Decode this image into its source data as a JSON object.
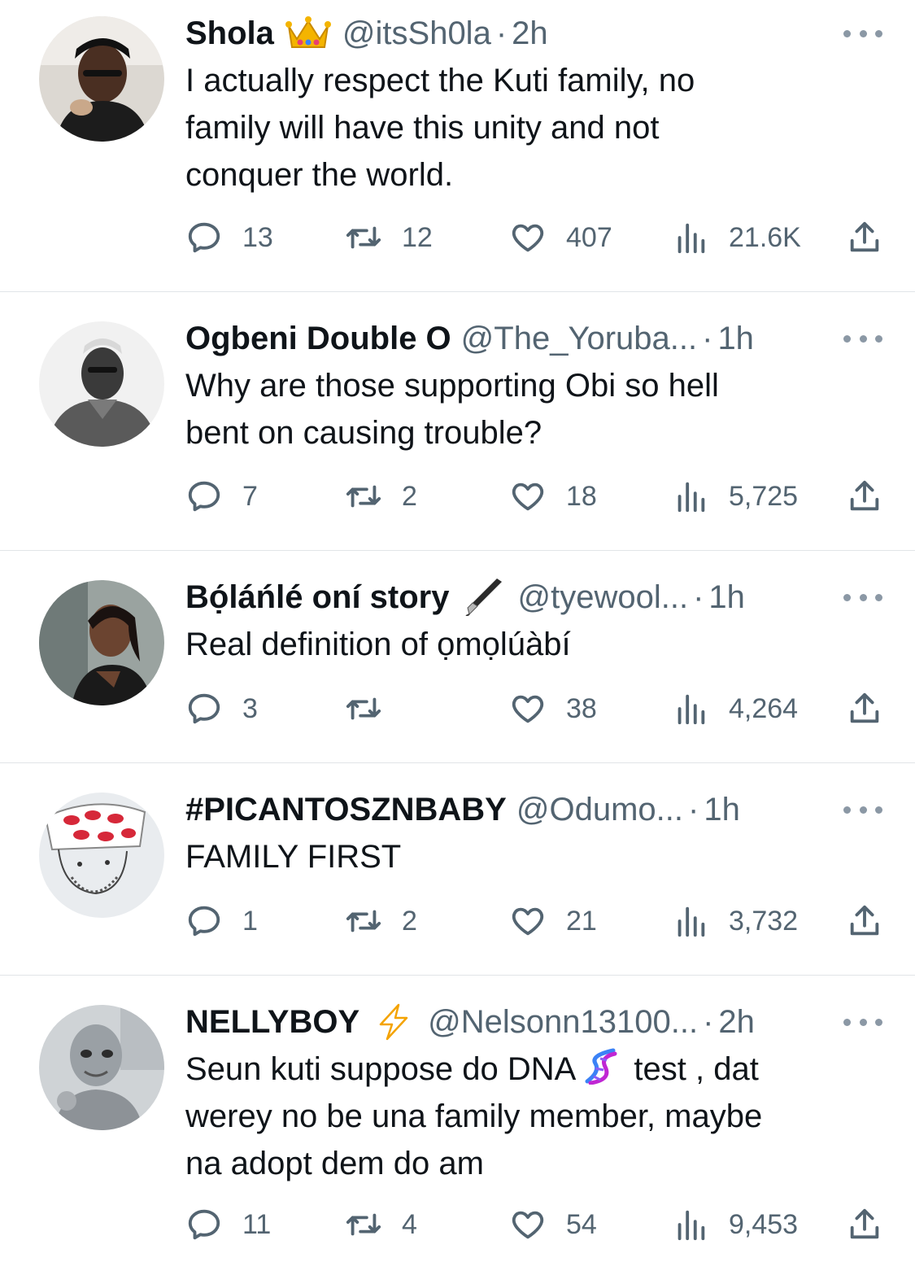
{
  "tweets": [
    {
      "name": "Shola",
      "badge": "crown-emoji",
      "handle": "@itsSh0la",
      "time": "2h",
      "text": "I actually respect the Kuti family, no\nfamily will have this unity and not\nconquer the world.",
      "replies": "13",
      "retweets": "12",
      "likes": "407",
      "views": "21.6K"
    },
    {
      "name": "Ogbeni Double O",
      "badge": "",
      "handle": "@The_Yoruba...",
      "time": "1h",
      "text": "Why are those supporting Obi so hell\nbent on causing trouble?",
      "replies": "7",
      "retweets": "2",
      "likes": "18",
      "views": "5,725"
    },
    {
      "name": "Bọ́láńlé oní story",
      "badge": "fountain-pen-emoji",
      "handle": "@tyewool...",
      "time": "1h",
      "text": "Real definition of ọmọlúàbí",
      "replies": "3",
      "retweets": "",
      "likes": "38",
      "views": "4,264"
    },
    {
      "name": "#PICANTOSZNBABY",
      "badge": "",
      "handle": "@Odumo...",
      "time": "1h",
      "text": "FAMILY FIRST",
      "replies": "1",
      "retweets": "2",
      "likes": "21",
      "views": "3,732"
    },
    {
      "name": "NELLYBOY",
      "badge": "lightning-emoji",
      "handle": "@Nelsonn13100...",
      "time": "2h",
      "text_before": "Seun kuti suppose do DNA",
      "text_emoji": "dna-emoji",
      "text_after": " test , dat\nwerey no be una family member, maybe\nna adopt dem do am",
      "replies": "11",
      "retweets": "4",
      "likes": "54",
      "views": "9,453"
    }
  ],
  "separator": "·",
  "colors": {
    "text": "#0f1419",
    "secondary": "#536471",
    "divider": "#e1e5e8",
    "background": "#ffffff"
  }
}
